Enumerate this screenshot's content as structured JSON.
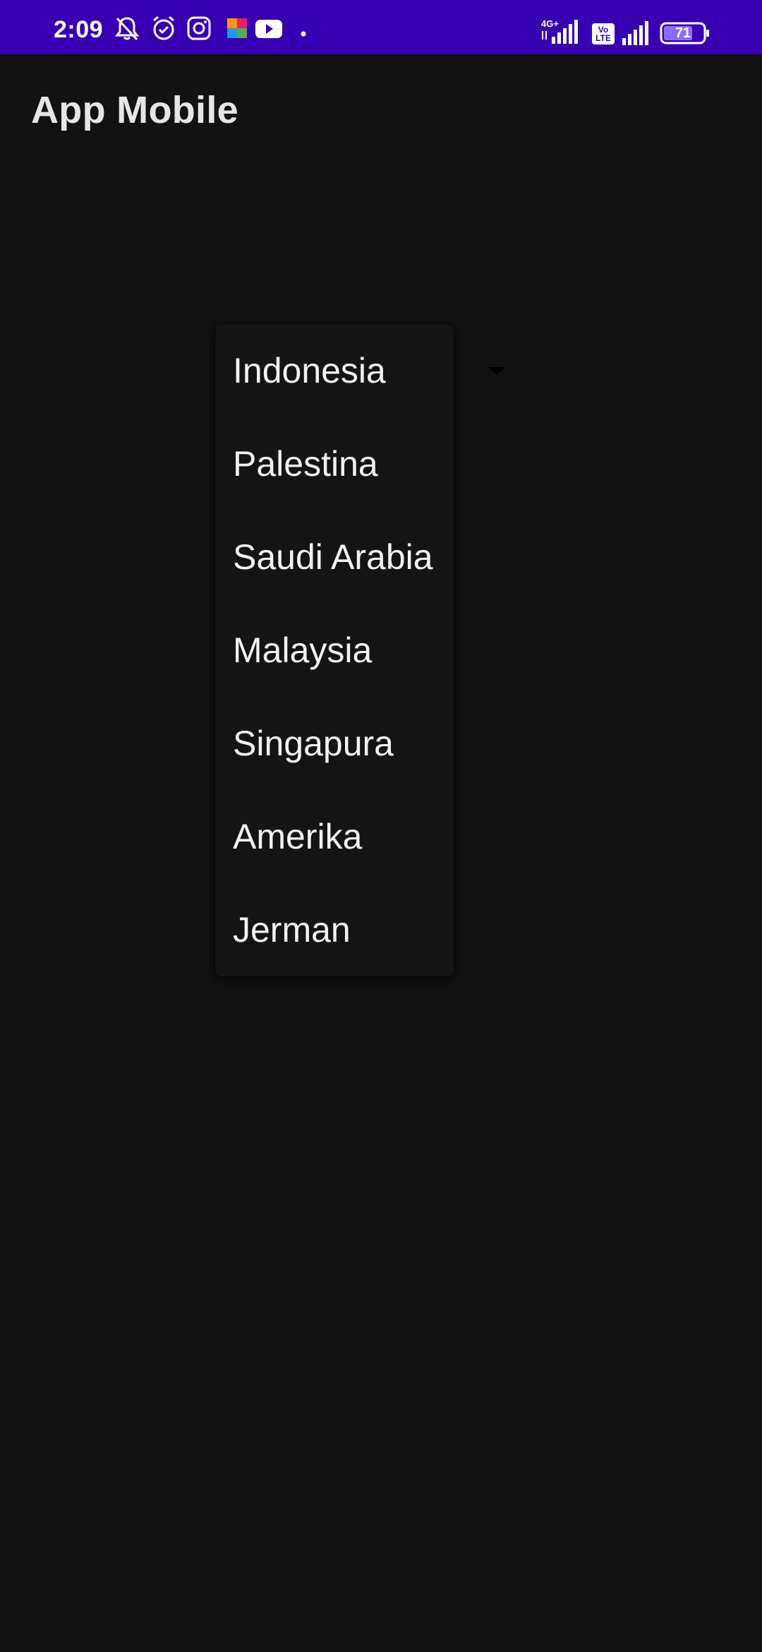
{
  "status_bar": {
    "time": "2:09",
    "icons": [
      "notifications-muted-icon",
      "alarm-icon",
      "instagram-icon",
      "app-icon",
      "youtube-icon",
      "dot-icon"
    ],
    "network_1": "4G+",
    "network_2": "Vo LTE",
    "battery": "71",
    "background_color": "#3700b3"
  },
  "app_bar": {
    "title": "App Mobile"
  },
  "spinner": {
    "selected": "Indonesia",
    "options": [
      "Indonesia",
      "Palestina",
      "Saudi Arabia",
      "Malaysia",
      "Singapura",
      "Amerika",
      "Jerman"
    ]
  }
}
